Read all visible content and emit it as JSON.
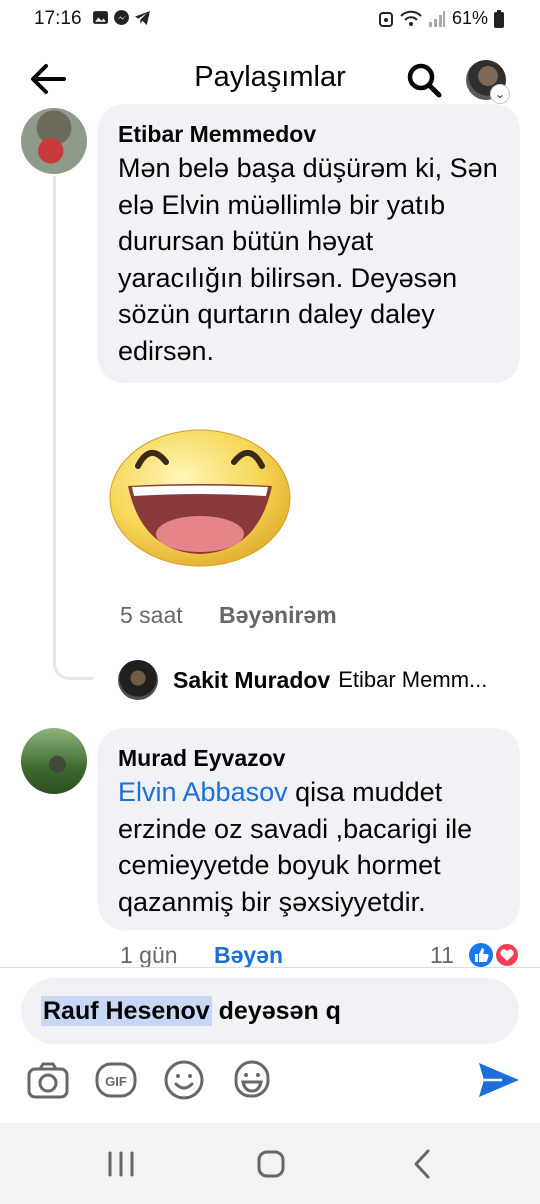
{
  "status_bar": {
    "time": "17:16",
    "battery": "61%"
  },
  "header": {
    "title": "Paylaşımlar"
  },
  "comments": [
    {
      "author": "Etibar Memmedov",
      "text": "Mən belə başa düşürəm ki, Sən elə Elvin müəllimlə bir yatıb durursan bütün həyat yaracılığın bilirsən. Deyəsən sözün qurtarın daley daley edirsən.",
      "time": "5 saat",
      "like_label": "Bəyənirəm",
      "reply": {
        "author": "Sakit Muradov",
        "snippet": "Etibar Memm..."
      }
    },
    {
      "author": "Murad Eyvazov",
      "mention": "Elvin Abbasov",
      "text": "  qisa muddet erzinde oz savadi ,bacarigi ile cemieyyetde boyuk hormet qazanmiş  bir  şəxsiyyetdir.",
      "time": "1 gün",
      "like_label": "Bəyən",
      "reaction_count": "11"
    }
  ],
  "composer": {
    "mention": "Rauf Hesenov",
    "text": " deyəsən q"
  },
  "colors": {
    "accent": "#1a6fd8",
    "bubble": "#f0f2f5",
    "like_blue": "#1877f2",
    "love_red": "#f33e58"
  }
}
